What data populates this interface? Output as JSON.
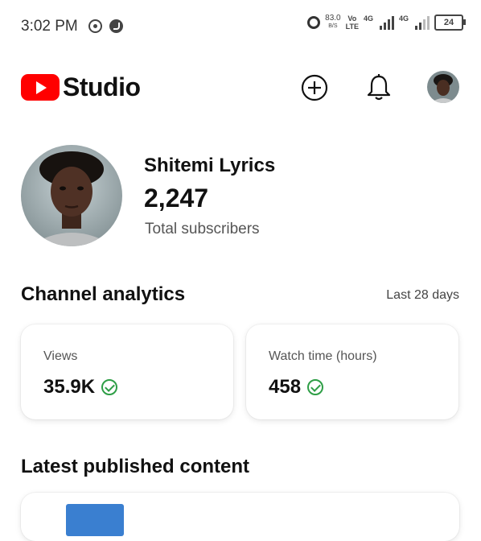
{
  "status_bar": {
    "time": "3:02 PM",
    "speed_value": "83.0",
    "speed_unit": "B/S",
    "volte_top": "Vo",
    "volte_bottom": "LTE",
    "net1": "4G",
    "net2": "4G",
    "battery": "24"
  },
  "header": {
    "logo_text": "Studio",
    "icons": [
      "add-icon",
      "bell-icon",
      "avatar"
    ]
  },
  "channel": {
    "name": "Shitemi Lyrics",
    "subscribers": "2,247",
    "subscribers_label": "Total subscribers"
  },
  "analytics": {
    "title": "Channel analytics",
    "range": "Last 28 days",
    "cards": [
      {
        "label": "Views",
        "value": "35.9K"
      },
      {
        "label": "Watch time (hours)",
        "value": "458"
      }
    ]
  },
  "latest": {
    "title": "Latest published content"
  },
  "colors": {
    "brand_red": "#ff0000",
    "check_green": "#2e9e46"
  }
}
